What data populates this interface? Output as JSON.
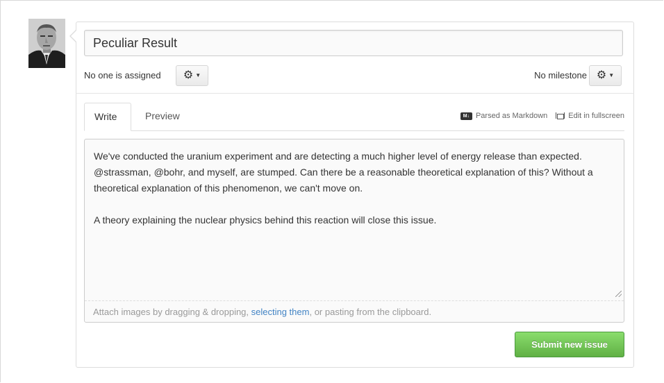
{
  "issue": {
    "title": "Peculiar Result",
    "assignee_text": "No one is assigned",
    "milestone_text": "No milestone"
  },
  "tabs": [
    {
      "label": "Write",
      "active": true
    },
    {
      "label": "Preview",
      "active": false
    }
  ],
  "tools": {
    "markdown_label": "Parsed as Markdown",
    "markdown_badge": "M↓",
    "fullscreen_label": "Edit in fullscreen"
  },
  "icons": {
    "gear": "gear-icon",
    "caret": "caret-down-icon",
    "markdown": "markdown-icon",
    "fullscreen": "fullscreen-icon"
  },
  "editor": {
    "body": "We've conducted the uranium experiment and are detecting a much higher level of energy release than expected. @strassman, @bohr, and myself, are stumped. Can there be a reasonable theoretical explanation of this? Without a theoretical explanation of this phenomenon, we can't move on.\n\nA theory explaining the nuclear physics behind this reaction will close this issue.",
    "attach_before": "Attach images by dragging & dropping, ",
    "attach_link": "selecting them",
    "attach_after": ", or pasting from the clipboard."
  },
  "actions": {
    "submit_label": "Submit new issue"
  },
  "colors": {
    "submit_bg": "#60b044",
    "link": "#4183c4"
  }
}
